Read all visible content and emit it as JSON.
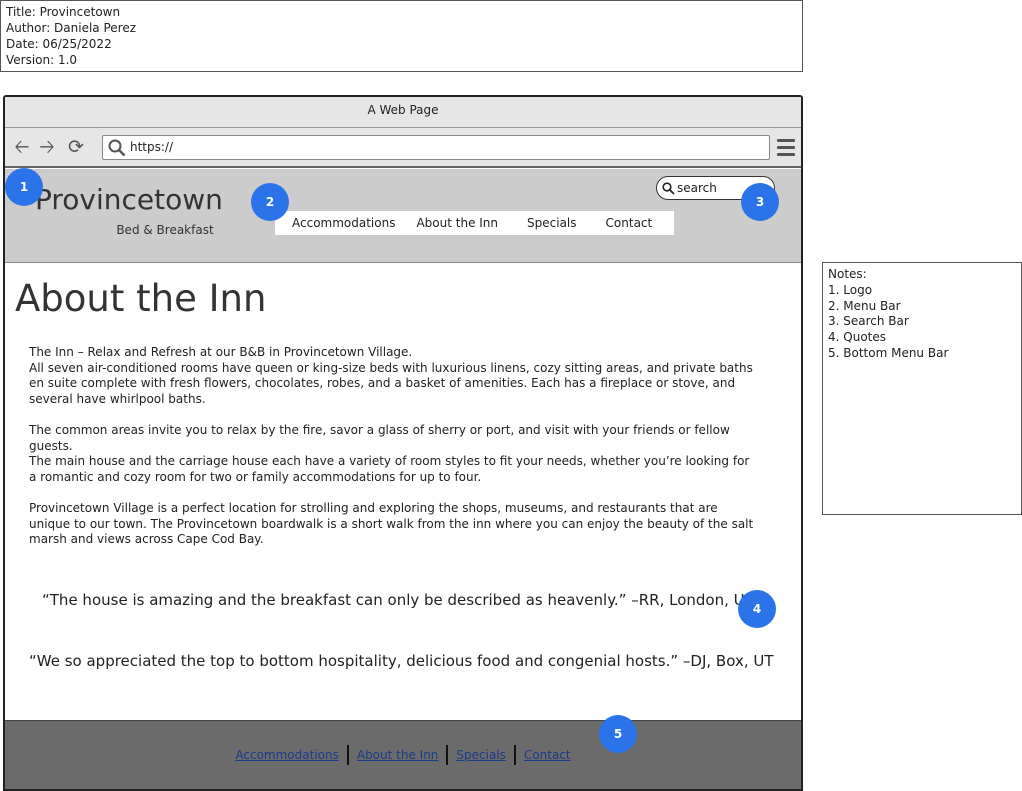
{
  "meta": {
    "title": "Title: Provincetown",
    "author": "Author: Daniela Perez",
    "date": "Date: 06/25/2022",
    "version": "Version: 1.0"
  },
  "browser": {
    "window_title": "A Web Page",
    "url": "https://",
    "icons": [
      "back-arrow-icon",
      "forward-arrow-icon",
      "refresh-icon",
      "search-icon",
      "hamburger-menu-icon"
    ]
  },
  "header": {
    "logo_title": "Provincetown",
    "logo_subtitle": "Bed & Breakfast",
    "search_placeholder": "search",
    "menu": [
      "Accommodations",
      "About the Inn",
      "Specials",
      "Contact"
    ]
  },
  "content": {
    "page_title": "About the Inn",
    "intro_line": "The Inn – Relax and Refresh at our B&B in Provincetown Village.",
    "paragraph1": "All seven air-conditioned rooms have queen or king-size beds with luxurious linens, cozy sitting areas, and private baths en suite complete with fresh flowers, chocolates, robes, and a basket of amenities. Each has a fireplace or stove, and several have whirlpool baths.",
    "paragraph2": "The common areas invite you to relax by the fire, savor a glass of sherry or port, and visit with your friends or fellow guests.",
    "paragraph3": "The main house and the carriage house each have a variety of room styles to fit your needs, whether you’re looking for a romantic and cozy room for two or family accommodations for up to four.",
    "paragraph4": "Provincetown Village is a perfect location for strolling and exploring the shops, museums, and restaurants that are unique to our town.  The Provincetown boardwalk is a short walk from the inn where you can enjoy the beauty of the salt marsh and views across Cape Cod Bay.",
    "quote1": "“The house is amazing and the breakfast can only be described as heavenly.” –RR, London, UK",
    "quote2": "“We so appreciated the top to bottom hospitality, delicious food and congenial hosts.” –DJ, Box, UT"
  },
  "footer": {
    "links": [
      "Accommodations",
      "About the Inn",
      "Specials",
      "Contact"
    ]
  },
  "markers": [
    "1",
    "2",
    "3",
    "4",
    "5"
  ],
  "notes": {
    "heading": "Notes:",
    "items": [
      "1. Logo",
      "2. Menu Bar",
      "3. Search Bar",
      "4. Quotes",
      "5. Bottom Menu Bar"
    ]
  },
  "colors": {
    "marker": "#2a73e8",
    "header_bg": "#cccccc",
    "footer_bg": "#6b6b6b",
    "link": "#1a3c8a"
  }
}
